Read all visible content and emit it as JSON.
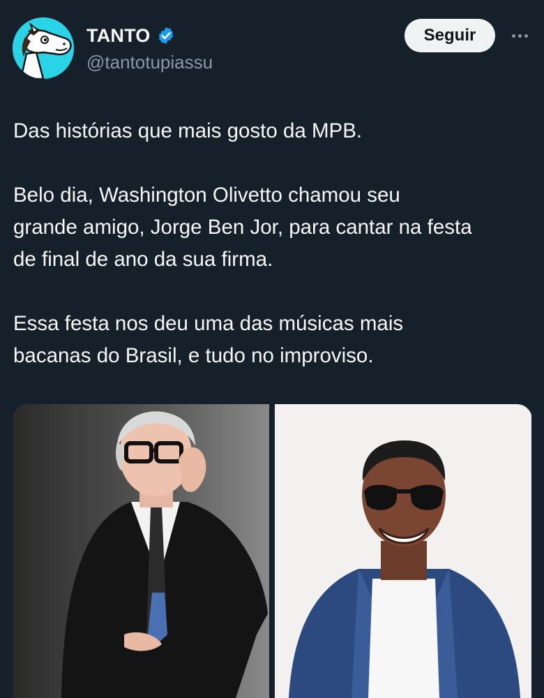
{
  "author": {
    "display_name": "TANTO",
    "handle": "@tantotupiassu",
    "verified": true,
    "avatar_icon": "cartoon-horse-avatar",
    "avatar_color": "#2ad3e6",
    "verified_color": "#1d9bf0"
  },
  "actions": {
    "follow_label": "Seguir",
    "more_icon": "more-horizontal-icon"
  },
  "tweet": {
    "paragraphs": [
      [
        "Das histórias que mais gosto da MPB."
      ],
      [
        "Belo dia, Washington Olivetto chamou seu",
        "grande amigo, Jorge Ben Jor, para cantar na festa",
        "de final de ano da sua firma."
      ],
      [
        "Essa festa nos deu uma das músicas mais",
        "bacanas do Brasil, e tudo no improviso."
      ]
    ]
  },
  "media": [
    {
      "icon": "photo-man-glasses-suit"
    },
    {
      "icon": "photo-smiling-man-sunglasses-denim-jacket"
    }
  ],
  "theme": {
    "background": "#15202b",
    "text": "#f7f9f9",
    "secondary_text": "#8b98a5",
    "button_bg": "#eff3f4"
  }
}
